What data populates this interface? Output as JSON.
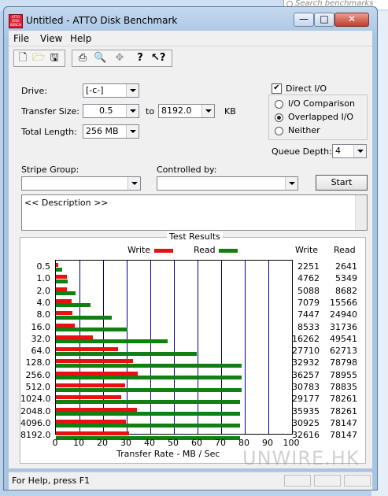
{
  "search_placeholder": "Search benchmarks",
  "window": {
    "title": "Untitled - ATTO Disk Benchmark",
    "icon_text": "ATTO DISK BENCH",
    "minimize": "—",
    "maximize": "□",
    "close": "✕"
  },
  "menu": [
    "File",
    "View",
    "Help"
  ],
  "toolbar_icons": [
    "new-document-icon",
    "open-folder-icon",
    "save-disk-icon",
    "print-icon",
    "print-preview-icon",
    "move-icon",
    "help-icon",
    "context-help-icon"
  ],
  "form": {
    "drive_label": "Drive:",
    "drive_value": "[-c-]",
    "transfer_size_label": "Transfer Size:",
    "transfer_from": "0.5",
    "to_label": "to",
    "transfer_to": "8192.0",
    "kb_label": "KB",
    "total_length_label": "Total Length:",
    "total_length_value": "256 MB",
    "direct_io_label": "Direct I/O",
    "direct_io_checked": true,
    "io_comparison_label": "I/O Comparison",
    "overlapped_io_label": "Overlapped I/O",
    "neither_label": "Neither",
    "selected_io_mode": "Overlapped I/O",
    "queue_depth_label": "Queue Depth:",
    "queue_depth_value": "4",
    "stripe_group_label": "Stripe Group:",
    "stripe_group_value": "",
    "controlled_by_label": "Controlled by:",
    "controlled_by_value": "",
    "start_label": "Start",
    "description_text": "<< Description >>"
  },
  "results": {
    "title": "Test Results",
    "legend_write": "Write",
    "legend_read": "Read",
    "col_write": "Write",
    "col_read": "Read",
    "write_color": "#e81010",
    "read_color": "#108010",
    "x_axis_label": "Transfer Rate - MB / Sec"
  },
  "chart_data": {
    "type": "bar",
    "orientation": "horizontal",
    "title": "Test Results",
    "xlabel": "Transfer Rate - MB / Sec",
    "ylabel": "",
    "xlim": [
      0,
      100
    ],
    "xticks": [
      0,
      10,
      20,
      30,
      40,
      50,
      60,
      70,
      80,
      90,
      100
    ],
    "grid": true,
    "legend": "top",
    "categories": [
      "0.5",
      "1.0",
      "2.0",
      "4.0",
      "8.0",
      "16.0",
      "32.0",
      "64.0",
      "128.0",
      "256.0",
      "512.0",
      "1024.0",
      "2048.0",
      "4096.0",
      "8192.0"
    ],
    "series": [
      {
        "name": "Write",
        "color": "#e81010",
        "values": [
          1,
          4.5,
          4.8,
          6.8,
          7.1,
          8.1,
          15.5,
          26.4,
          32.5,
          34.6,
          29.4,
          27.8,
          34.3,
          29.5,
          31.1
        ],
        "raw_values": [
          2251,
          4762,
          5088,
          7079,
          7447,
          8533,
          16262,
          27710,
          32932,
          36257,
          30783,
          29177,
          35935,
          30925,
          32616
        ]
      },
      {
        "name": "Read",
        "color": "#108010",
        "values": [
          2.5,
          5.1,
          8.3,
          14.8,
          23.8,
          30.3,
          47.3,
          59.8,
          78.5,
          78.7,
          78.5,
          78.0,
          78.0,
          78.0,
          78.0
        ],
        "raw_values": [
          2641,
          5349,
          8682,
          15566,
          24940,
          31736,
          49541,
          62713,
          78798,
          78955,
          78835,
          78261,
          78261,
          78147,
          78147
        ]
      }
    ]
  },
  "status_text": "For Help, press F1",
  "watermark": "UNWIRE.HK"
}
